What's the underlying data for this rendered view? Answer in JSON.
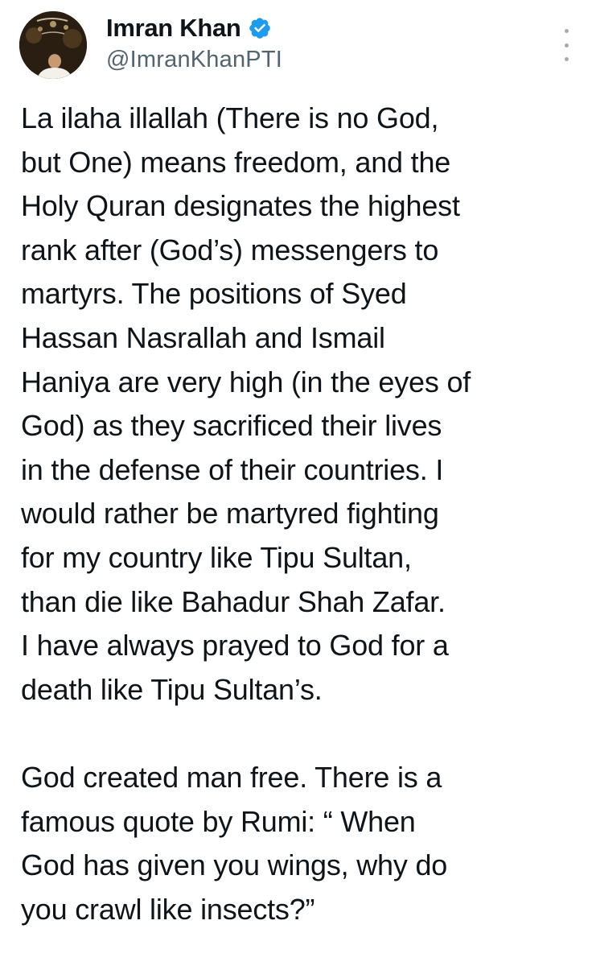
{
  "author": {
    "name": "Imran Khan",
    "handle": "@ImranKhanPTI",
    "verified": true,
    "verified_color": "#1d9bf0",
    "avatar_icon": "profile-photo"
  },
  "menu_icon": "more-vertical-icon",
  "tweet": {
    "text": "La ilaha illallah (There is no God,\nbut One) means freedom, and the\nHoly Quran designates the highest\nrank after (God’s) messengers to\nmartyrs. The positions of Syed\nHassan Nasrallah and Ismail\nHaniya are very high (in the eyes of\nGod) as they sacrificed their lives\nin the defense of their countries. I\nwould rather be martyred fighting\nfor my country like Tipu Sultan,\nthan die like Bahadur Shah Zafar.\nI have always prayed to God for a\ndeath like Tipu Sultan’s.\n\nGod created man free. There is a\nfamous quote by Rumi: “ When\nGod has given you wings, why do\nyou crawl like insects?”"
  },
  "colors": {
    "text": "#0f1419",
    "secondary": "#536471",
    "accent": "#1d9bf0"
  }
}
